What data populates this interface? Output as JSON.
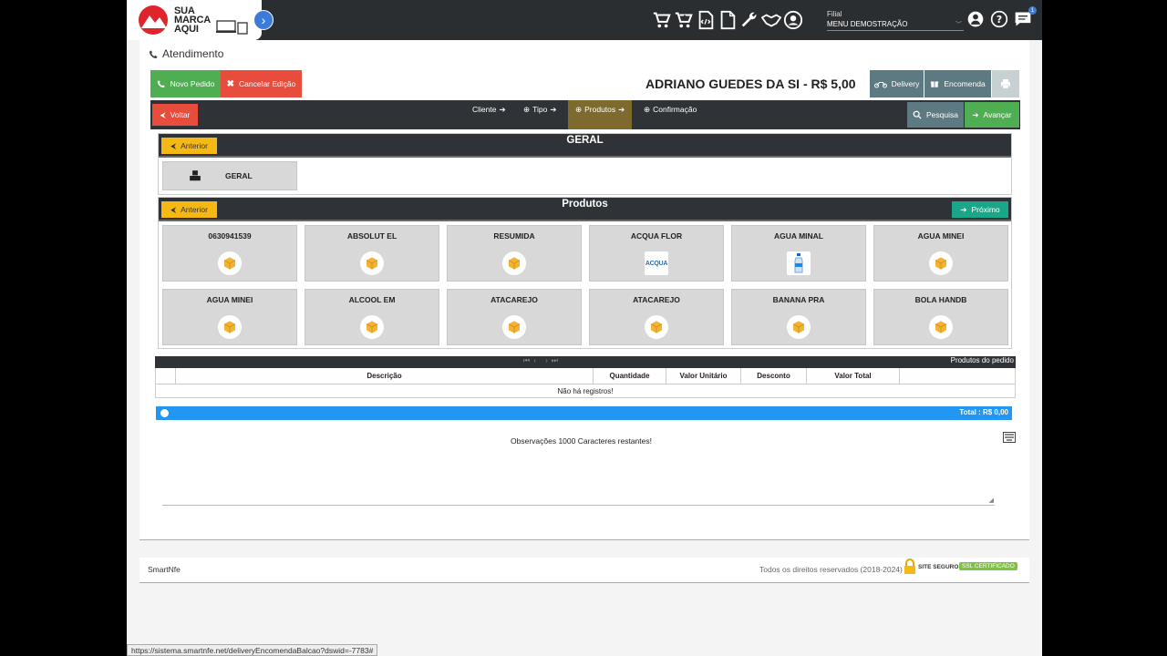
{
  "header": {
    "logo_text_1": "SUA",
    "logo_text_2": "MARCA",
    "logo_text_3": "AQUI",
    "filial_label": "Filial",
    "filial_value": "MENU DEMOSTRAÇÃO",
    "notif_count": "1",
    "icons": [
      "cart-icon",
      "cart-add-icon",
      "xml-file-icon",
      "file-icon",
      "wrench-icon",
      "handshake-icon",
      "user-circle-icon"
    ]
  },
  "page": {
    "section_title": "Atendimento",
    "customer_total": "ADRIANO GUEDES DA SI - R$ 5,00"
  },
  "toolbar": {
    "novo_pedido": "Novo Pedido",
    "cancelar_edicao": "Cancelar Edição",
    "delivery": "Delivery",
    "encomenda": "Encomenda",
    "voltar": "Voltar",
    "pesquisa": "Pesquisa",
    "avancar": "Avançar"
  },
  "steps": [
    {
      "label": "Cliente"
    },
    {
      "label": "Tipo"
    },
    {
      "label": "Produtos"
    },
    {
      "label": "Confirmação"
    }
  ],
  "categories_panel": {
    "title": "GERAL",
    "anterior": "Anterior",
    "items": [
      {
        "name": "GERAL"
      }
    ]
  },
  "products_panel": {
    "title": "Produtos",
    "anterior": "Anterior",
    "proximo": "Próximo",
    "items": [
      {
        "name": "0630941539"
      },
      {
        "name": "ABSOLUT EL"
      },
      {
        "name": "RESUMIDA"
      },
      {
        "name": "ACQUA FLOR",
        "image_text": "ACQUA"
      },
      {
        "name": "AGUA MINAL"
      },
      {
        "name": "AGUA MINEI"
      },
      {
        "name": "AGUA MINEI"
      },
      {
        "name": "ALCOOL EM"
      },
      {
        "name": "ATACAREJO"
      },
      {
        "name": "ATACAREJO"
      },
      {
        "name": "BANANA PRA"
      },
      {
        "name": "BOLA HANDB"
      }
    ]
  },
  "order_table": {
    "title": "Produtos do pedido",
    "columns": [
      "Descrição",
      "Quantidade",
      "Valor Unitário",
      "Desconto",
      "Valor Total"
    ],
    "empty_text": "Não há registros!",
    "total": "Total : R$ 0,00"
  },
  "observacoes": "Observações 1000 Caracteres restantes!",
  "footer": {
    "brand": "SmartNfe",
    "rights": "Todos os direitos reservados (2018-2024)",
    "ssl_text": "SITE SEGURO",
    "ssl_badge": "SSL CERTIFICADO"
  },
  "status_url": "https://sistema.smartnfe.net/deliveryEncomendaBalcao?dswid=-7783#"
}
